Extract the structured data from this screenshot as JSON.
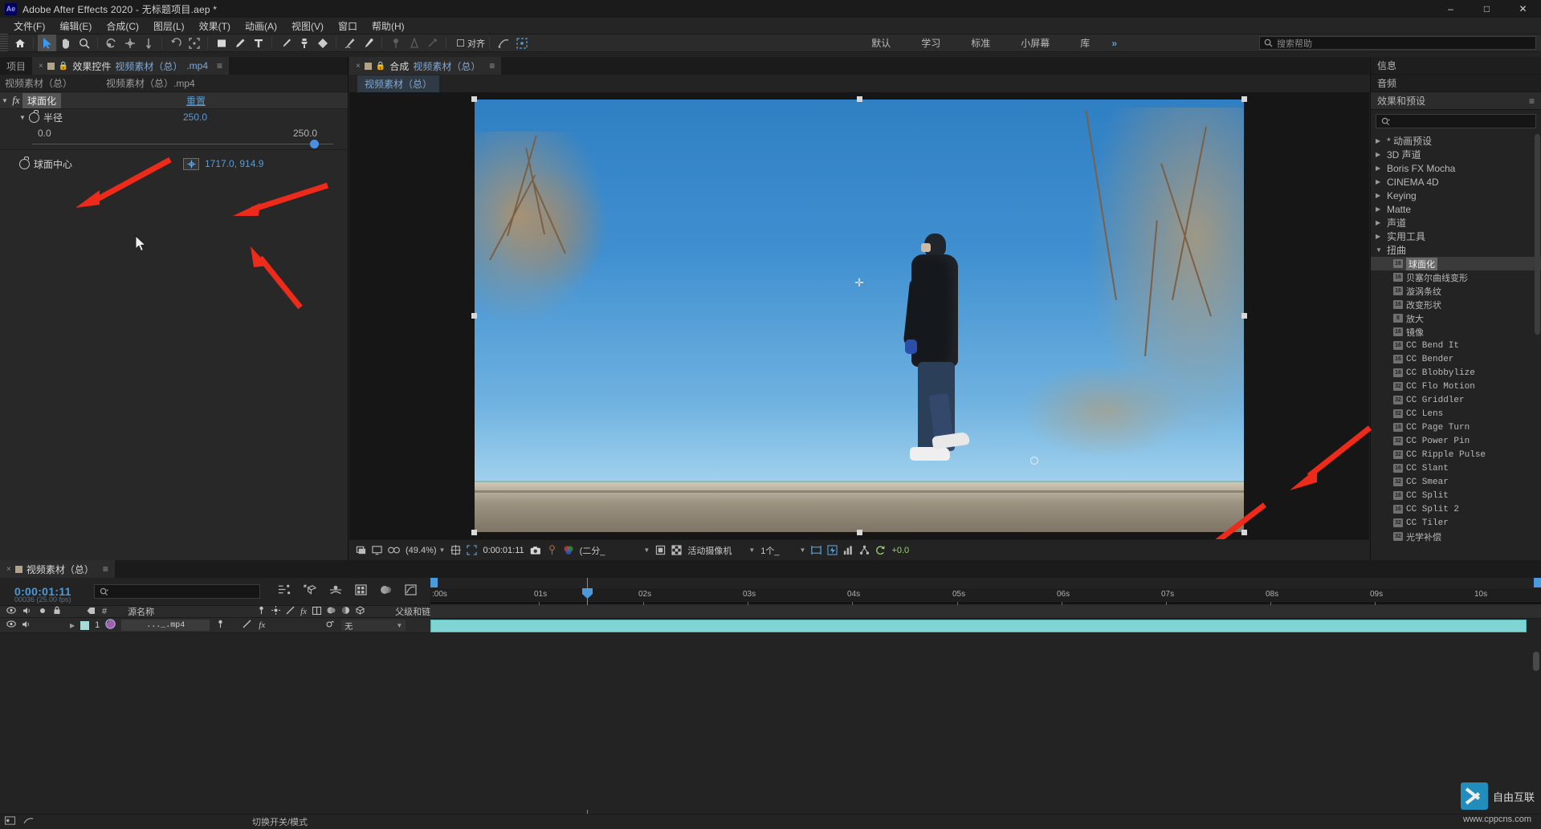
{
  "titlebar": {
    "logo": "Ae",
    "title": "Adobe After Effects 2020 - 无标题项目.aep *",
    "minimize": "–",
    "maximize": "□",
    "close": "✕"
  },
  "menubar": {
    "items": [
      "文件(F)",
      "编辑(E)",
      "合成(C)",
      "图层(L)",
      "效果(T)",
      "动画(A)",
      "视图(V)",
      "窗口",
      "帮助(H)"
    ]
  },
  "toolbar": {
    "align_label": "对齐",
    "workspaces": [
      "默认",
      "学习",
      "标准",
      "小屏幕",
      "库"
    ],
    "overflow": "»",
    "help_placeholder": "搜索帮助"
  },
  "effect_controls": {
    "tab_project": "项目",
    "tab_close": "×",
    "tab_title": "效果控件",
    "tab_comp_name": "视频素材（总）",
    "tab_ext": ".mp4",
    "menu_icon": "≡",
    "sub_left": "视频素材（总）",
    "sub_right": "视频素材（总）.mp4",
    "effect_name": "球面化",
    "reset_label": "重置",
    "properties": [
      {
        "name": "半径",
        "value": "250.0",
        "slider_min": "0.0",
        "slider_max": "250.0"
      }
    ],
    "center_property": {
      "name": "球面中心",
      "value": "1717.0, 914.9"
    }
  },
  "composition": {
    "tab_close": "×",
    "tab_label": "合成",
    "tab_name": "视频素材（总）",
    "menu_icon": "≡",
    "breadcrumb": "视频素材（总）",
    "toolbar": {
      "zoom": "(49.4%)",
      "timecode": "0:00:01:11",
      "resolution": "(二分_",
      "camera": "活动摄像机",
      "views": "1个_",
      "exposure": "+0.0"
    }
  },
  "right_panel": {
    "tabs": [
      "信息",
      "音频",
      "效果和预设"
    ],
    "menu_icon": "≡",
    "search_placeholder": "",
    "tree": [
      {
        "type": "group",
        "label": "* 动画预设",
        "expanded": false
      },
      {
        "type": "group",
        "label": "3D 声道",
        "expanded": false
      },
      {
        "type": "group",
        "label": "Boris FX Mocha",
        "expanded": false
      },
      {
        "type": "group",
        "label": "CINEMA 4D",
        "expanded": false
      },
      {
        "type": "group",
        "label": "Keying",
        "expanded": false
      },
      {
        "type": "group",
        "label": "Matte",
        "expanded": false
      },
      {
        "type": "group",
        "label": "声道",
        "expanded": false
      },
      {
        "type": "group",
        "label": "实用工具",
        "expanded": false
      },
      {
        "type": "group",
        "label": "扭曲",
        "expanded": true
      },
      {
        "type": "effect",
        "bits": "16",
        "label": "球面化",
        "selected": true
      },
      {
        "type": "effect",
        "bits": "16",
        "label": "贝塞尔曲线变形"
      },
      {
        "type": "effect",
        "bits": "16",
        "label": "漩涡条纹"
      },
      {
        "type": "effect",
        "bits": "16",
        "label": "改变形状"
      },
      {
        "type": "effect",
        "bits": "8",
        "label": "放大"
      },
      {
        "type": "effect",
        "bits": "16",
        "label": "镜像"
      },
      {
        "type": "effect",
        "bits": "16",
        "label": "CC Bend It"
      },
      {
        "type": "effect",
        "bits": "16",
        "label": "CC Bender"
      },
      {
        "type": "effect",
        "bits": "16",
        "label": "CC Blobbylize"
      },
      {
        "type": "effect",
        "bits": "32",
        "label": "CC Flo Motion"
      },
      {
        "type": "effect",
        "bits": "32",
        "label": "CC Griddler"
      },
      {
        "type": "effect",
        "bits": "32",
        "label": "CC Lens"
      },
      {
        "type": "effect",
        "bits": "16",
        "label": "CC Page Turn"
      },
      {
        "type": "effect",
        "bits": "32",
        "label": "CC Power Pin"
      },
      {
        "type": "effect",
        "bits": "32",
        "label": "CC Ripple Pulse"
      },
      {
        "type": "effect",
        "bits": "16",
        "label": "CC Slant"
      },
      {
        "type": "effect",
        "bits": "32",
        "label": "CC Smear"
      },
      {
        "type": "effect",
        "bits": "16",
        "label": "CC Split"
      },
      {
        "type": "effect",
        "bits": "16",
        "label": "CC Split 2"
      },
      {
        "type": "effect",
        "bits": "32",
        "label": "CC Tiler"
      },
      {
        "type": "effect",
        "bits": "32",
        "label": "光学补偿"
      }
    ]
  },
  "timeline": {
    "tab_close": "×",
    "tab_name": "视频素材（总）",
    "menu_icon": "≡",
    "current_time": "0:00:01:11",
    "frame_info": "00036 (25.00 fps)",
    "search_placeholder": "",
    "columns": {
      "hash": "#",
      "source_name": "源名称",
      "parent_link": "父级和链接"
    },
    "layers": [
      {
        "index": "1",
        "source_name": "..._.mp4",
        "parent": "无"
      }
    ],
    "ruler_ticks": [
      ":00s",
      "01s",
      "02s",
      "03s",
      "04s",
      "05s",
      "06s",
      "07s",
      "08s",
      "09s",
      "10s"
    ],
    "bottom_label": "切换开关/模式"
  },
  "watermark": {
    "brand": "自由互联",
    "sub": "www.cppcns.com"
  },
  "colors": {
    "accent_blue": "#5b9bd5",
    "timecode_blue": "#4a9adc",
    "layer_bar": "#7fd4d4",
    "arrow_red": "#ee2b1a",
    "panel_bg": "#232323"
  }
}
